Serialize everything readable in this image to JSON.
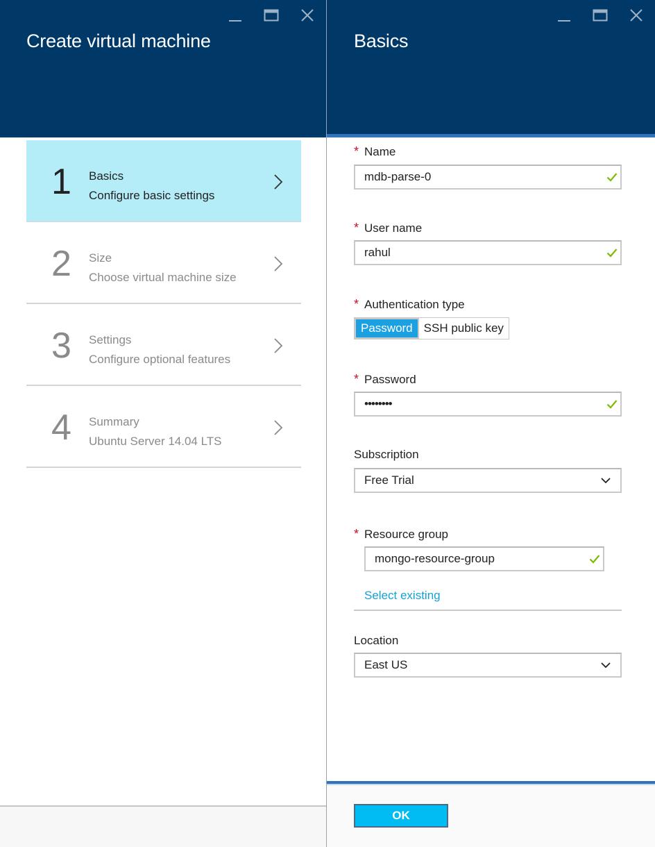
{
  "left_blade": {
    "title": "Create virtual machine",
    "steps": [
      {
        "number": "1",
        "title": "Basics",
        "description": "Configure basic settings",
        "active": true
      },
      {
        "number": "2",
        "title": "Size",
        "description": "Choose virtual machine size",
        "active": false
      },
      {
        "number": "3",
        "title": "Settings",
        "description": "Configure optional features",
        "active": false
      },
      {
        "number": "4",
        "title": "Summary",
        "description": "Ubuntu Server 14.04 LTS",
        "active": false
      }
    ]
  },
  "right_blade": {
    "title": "Basics",
    "fields": {
      "name": {
        "label": "Name",
        "value": "mdb-parse-0",
        "required": "*"
      },
      "user_name": {
        "label": "User name",
        "value": "rahul",
        "required": "*"
      },
      "auth_type": {
        "label": "Authentication type",
        "required": "*",
        "options": [
          "Password",
          "SSH public key"
        ],
        "selected": "Password"
      },
      "password": {
        "label": "Password",
        "value": "••••••••",
        "required": "*"
      },
      "subscription": {
        "label": "Subscription",
        "value": "Free Trial"
      },
      "resource_group": {
        "label": "Resource group",
        "value": "mongo-resource-group",
        "required": "*",
        "link": "Select existing"
      },
      "location": {
        "label": "Location",
        "value": "East US"
      }
    },
    "ok_label": "OK"
  },
  "colors": {
    "header_bg": "#003868",
    "active_step_bg": "#b4ecf8",
    "accent_blue": "#00bcf2",
    "link_blue": "#13a2d4",
    "check_green": "#7fba00",
    "required_red": "#c8102e"
  },
  "icons": {
    "minimize": "minimize-icon",
    "maximize": "maximize-icon",
    "close": "close-icon",
    "chevron_right": "chevron-right-icon",
    "chevron_down": "chevron-down-icon",
    "check": "check-icon"
  }
}
